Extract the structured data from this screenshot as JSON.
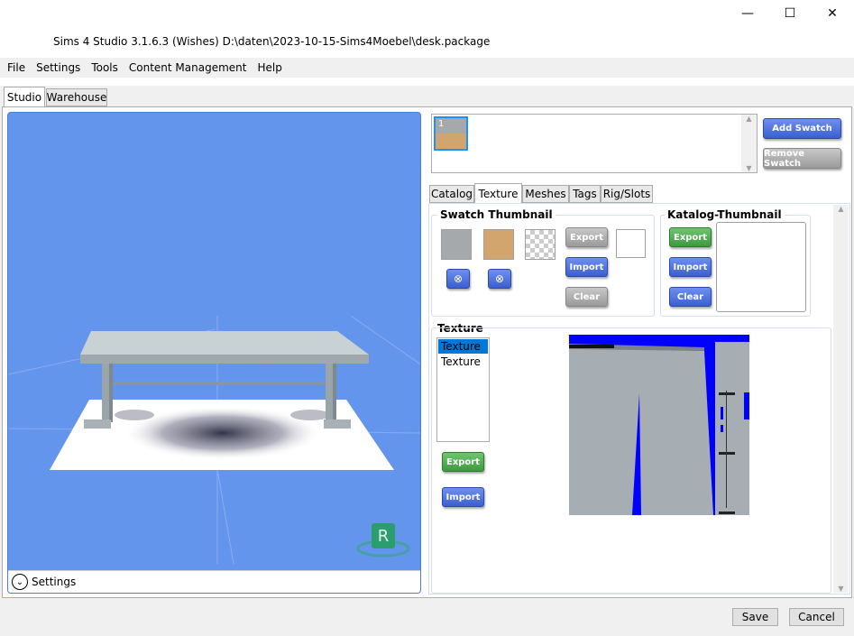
{
  "window": {
    "title": "Sims 4 Studio 3.1.6.3 (Wishes)  D:\\daten\\2023-10-15-Sims4Moebel\\desk.package",
    "minimize": "—",
    "maximize": "☐",
    "close": "✕"
  },
  "menu": [
    "File",
    "Settings",
    "Tools",
    "Content Management",
    "Help"
  ],
  "main_tabs": [
    {
      "label": "Studio"
    },
    {
      "label": "Warehouse"
    }
  ],
  "viewport": {
    "settings_label": "Settings",
    "badge_letter": "R"
  },
  "swatches": {
    "item_label": "1",
    "add_button": "Add Swatch",
    "remove_button": "Remove Swatch",
    "swatch_colors": [
      "#a6a9ab",
      "#d2a56e"
    ]
  },
  "sub_tabs": [
    {
      "label": "Catalog"
    },
    {
      "label": "Texture"
    },
    {
      "label": "Meshes"
    },
    {
      "label": "Tags"
    },
    {
      "label": "Rig/Slots"
    }
  ],
  "swatch_thumbnail": {
    "title": "Swatch Thumbnail",
    "export": "Export",
    "import": "Import",
    "clear": "Clear",
    "colors": [
      "#a6a9ab",
      "#d2a56e"
    ]
  },
  "catalog_thumbnail": {
    "title": "Katalog-Thumbnail",
    "export": "Export",
    "import": "Import",
    "clear": "Clear"
  },
  "texture": {
    "title": "Texture",
    "items": [
      "Texture",
      "Texture"
    ],
    "export": "Export",
    "import": "Import"
  },
  "footer": {
    "save": "Save",
    "cancel": "Cancel"
  },
  "colors": {
    "viewport_bg": "#6495ed",
    "texture_blue": "#0000ff",
    "texture_gray": "#a6aeb4"
  }
}
